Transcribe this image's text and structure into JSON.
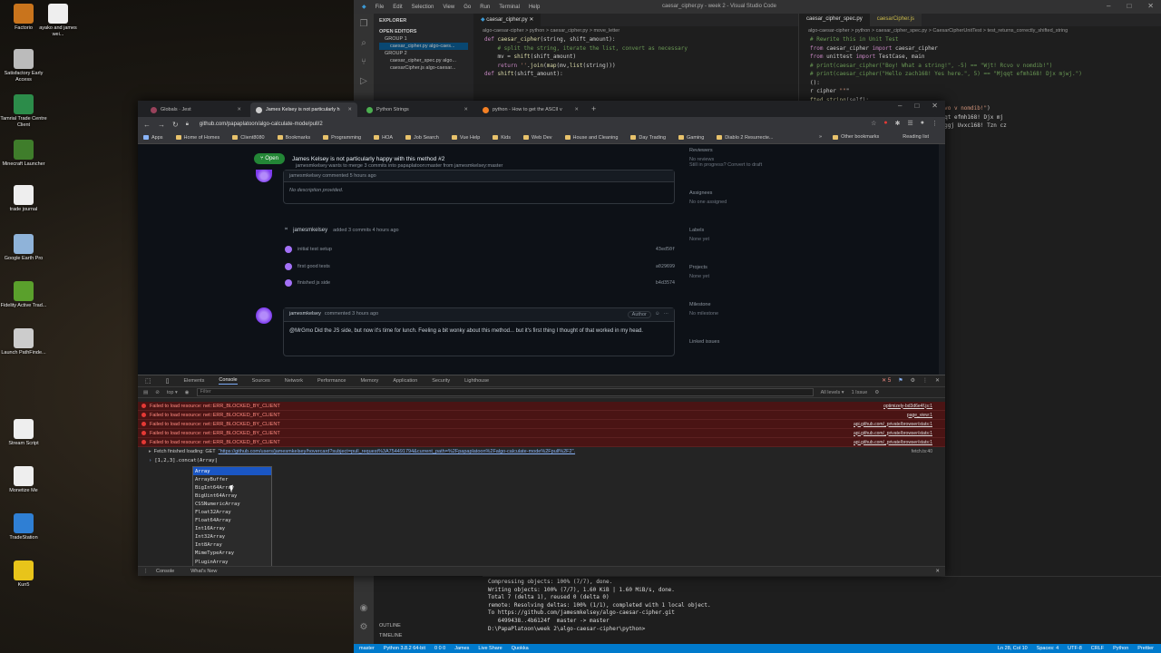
{
  "desktop": {
    "icons": [
      {
        "label": "Factorio",
        "color": "#c9741c"
      },
      {
        "label": "ayako and james wei...",
        "color": "#eeeeee"
      },
      {
        "label": "Satisfactory Early Access",
        "color": "#bbbbbb"
      },
      {
        "label": "Tamrial Trade Centre Client",
        "color": "#2c8c4a"
      },
      {
        "label": "Minecraft Launcher",
        "color": "#3f7d2b"
      },
      {
        "label": "trade journal",
        "color": "#eeeeee"
      },
      {
        "label": "Google Earth Pro",
        "color": "#8fb3d9"
      },
      {
        "label": "Fidelity Active Trad...",
        "color": "#5aa02c"
      },
      {
        "label": "Launch PathFinde...",
        "color": "#cccccc"
      },
      {
        "label": "Stream Script",
        "color": "#eeeeee"
      },
      {
        "label": "Monetize Me",
        "color": "#eeeeee"
      },
      {
        "label": "TradeStation",
        "color": "#2f7fd4"
      },
      {
        "label": "Kun5",
        "color": "#e8c41a"
      }
    ]
  },
  "vscode": {
    "title": "caesar_cipher.py - week 2 - Visual Studio Code",
    "menu": [
      "File",
      "Edit",
      "Selection",
      "View",
      "Go",
      "Run",
      "Terminal",
      "Help"
    ],
    "explorer": {
      "header": "EXPLORER",
      "open_editors": "OPEN EDITORS",
      "group1": "GROUP 1",
      "g1_file": "caesar_cipher.py algo-caes...",
      "group2": "GROUP 2",
      "g2_files": [
        "caesar_cipher_spec.py algo...",
        "caesarCipher.js algo-caesar..."
      ]
    },
    "editor1": {
      "tab": "caesar_cipher.py",
      "crumbs": "algo-caesar-cipher > python > caesar_cipher.py > move_letter",
      "lines": [
        "def caesar_cipher(string, shift_amount):",
        "    # split the string, iterate the list, convert as necessary",
        "    mv = shift(shift_amount)",
        "    return ''.join(map(mv,list(string)))",
        "",
        "def shift(shift_amount):"
      ]
    },
    "editor2": {
      "tabs": [
        "caesar_cipher_spec.py",
        "caesarCipher.js"
      ],
      "crumbs": "algo-caesar-cipher > python > caesar_cipher_spec.py > CaesarCipherUnitTest > test_returns_correctly_shifted_string",
      "lines": [
        "# Rewrite this in Unit Test",
        "",
        "from caesar_cipher import caesar_cipher",
        "from unittest import TestCase, main",
        "# print(caesar_cipher(\"Boy! What a string!\", -5) == \"Wjt! Rcvo v nomdib!\")",
        "# print(caesar_cipher(\"Hello zach168! Yes here.\", 5) == \"Mjqqt efmh168! Djx mjwj.\")",
        "",
        "",
        "():",
        "r cipher \"\"\"",
        "fted_string(self):",
        "pher(\"Boy! What a string!\", -5), \"Wjt! Rcvo v nomdib!\")",
        "pher(\"Hello zach168! Yes here.\", 5), \"Mjqqt efmh168! Djx mj",
        "pher(\"Hello Zach168! Yes here.\", -5), \"Czggj Uvxc168! Tzn cz"
      ]
    },
    "sidebar_bottom": [
      "OUTLINE",
      "TIMELINE"
    ],
    "terminal": [
      "Compressing objects: 100% (7/7), done.",
      "Writing objects: 100% (7/7), 1.60 KiB | 1.60 MiB/s, done.",
      "Total 7 (delta 1), reused 0 (delta 0)",
      "remote: Resolving deltas: 100% (1/1), completed with 1 local object.",
      "To https://github.com/jamesmkelsey/algo-caesar-cipher.git",
      "   6499438..4b6124f  master -> master",
      "",
      "D:\\PapaPlatoon\\week 2\\algo-caesar-cipher\\python>"
    ],
    "status_left": [
      "master",
      "Python 3.8.2 64-bit",
      "0 0 0",
      "James",
      "Live Share",
      "Quokka"
    ],
    "status_right": [
      "Ln 28, Col 10",
      "Spaces: 4",
      "UTF-8",
      "CRLF",
      "Python",
      "Prettier"
    ]
  },
  "chrome": {
    "tabs": [
      {
        "title": "Globals · Jest",
        "color": "#99425b"
      },
      {
        "title": "James Kelsey is not particularly h",
        "color": "#cccccc"
      },
      {
        "title": "Python Strings",
        "color": "#4caf50"
      },
      {
        "title": "python - How to get the ASCII v",
        "color": "#f48024"
      }
    ],
    "url": "github.com/papaplatoon/algo-calculate-mode/pull/2",
    "bookmarks": [
      "Apps",
      "Home of Homes",
      "Client8080",
      "Bookmarks",
      "Programming",
      "HOA",
      "Job Search",
      "Vue Help",
      "Kids",
      "Web Dev",
      "House and Cleaning",
      "Day Trading",
      "Gaming",
      "Diablo 2 Resurrecte..."
    ],
    "bookmarks_right": [
      "Other bookmarks",
      "Reading list"
    ]
  },
  "github": {
    "state": "Open",
    "title": "James Kelsey is not particularly happy with this method #2",
    "subtitle": "jamesmkelsey wants to merge 3 commits into papaplatoon:master from jamesmkelsey:master",
    "first_comment_author": "jamesmkelsey commented 5 hours ago",
    "no_description": "No description provided.",
    "commits_header_user": "jamesmkelsey",
    "commits_header_text": "added 3 commits 4 hours ago",
    "commits": [
      {
        "msg": "initial test setup",
        "sha": "43ed50f"
      },
      {
        "msg": "first good tests",
        "sha": "a029699"
      },
      {
        "msg": "finished js side",
        "sha": "b4d3574"
      }
    ],
    "comment2_author": "jamesmkelsey",
    "comment2_time": "commented 3 hours ago",
    "comment2_badge": "Author",
    "comment2_body": "@MrGmo Did the JS side, but now it's time for lunch. Feeling a bit wonky about this method... but it's first thing I thought of that worked in my head.",
    "sidebar": [
      {
        "h": "Reviewers",
        "v": "No reviews\nStill in progress? Convert to draft"
      },
      {
        "h": "Assignees",
        "v": "No one assigned"
      },
      {
        "h": "Labels",
        "v": "None yet"
      },
      {
        "h": "Projects",
        "v": "None yet"
      },
      {
        "h": "Milestone",
        "v": "No milestone"
      },
      {
        "h": "Linked issues",
        "v": ""
      }
    ]
  },
  "devtools": {
    "tabs": [
      "Elements",
      "Console",
      "Sources",
      "Network",
      "Performance",
      "Memory",
      "Application",
      "Security",
      "Lighthouse"
    ],
    "active_tab": "Console",
    "context": "top",
    "filter_placeholder": "Filter",
    "levels": "All levels",
    "issues": "1 Issue",
    "error_count": "5",
    "errors": [
      {
        "text": "Failed to load resource: net::ERR_BLOCKED_BY_CLIENT",
        "src": "optimizely-bd3d6e4f.js:1"
      },
      {
        "text": "Failed to load resource: net::ERR_BLOCKED_BY_CLIENT",
        "src": "page_view:1"
      },
      {
        "text": "Failed to load resource: net::ERR_BLOCKED_BY_CLIENT",
        "src": "api.github.com/_private/browser/stats:1"
      },
      {
        "text": "Failed to load resource: net::ERR_BLOCKED_BY_CLIENT",
        "src": "api.github.com/_private/browser/stats:1"
      },
      {
        "text": "Failed to load resource: net::ERR_BLOCKED_BY_CLIENT",
        "src": "api.github.com/_private/browser/stats:1"
      }
    ],
    "fetch_log": "Fetch finished loading: GET",
    "fetch_url": "\"https://github.com/users/jamesmkelsey/hovercard?subject=pull_request%3A754491794&current_path=%2Fpapaplatoon%2Falgo-calculate-mode%2Fpull%2F2\".",
    "fetch_src": "fetch.ts:40",
    "input": "[1,2,3].concat(Array",
    "autocomplete": [
      "Array",
      "ArrayBuffer",
      "BigInt64Array",
      "BigUint64Array",
      "CSSNumericArray",
      "Float32Array",
      "Float64Array",
      "Int16Array",
      "Int32Array",
      "Int8Array",
      "MimeTypeArray",
      "PluginArray",
      "WhUint16Array"
    ],
    "drawer_tabs": [
      "Console",
      "What's New"
    ]
  }
}
